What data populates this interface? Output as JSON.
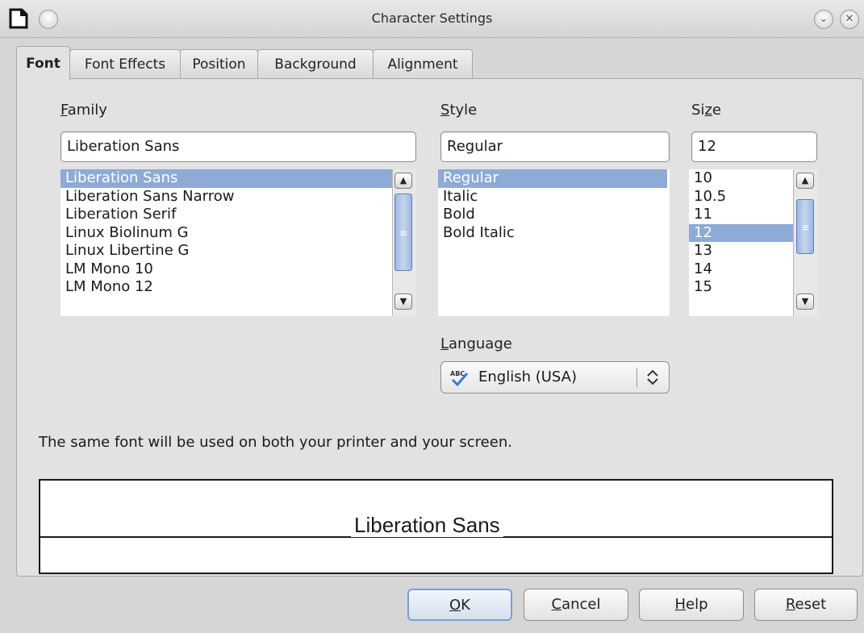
{
  "window": {
    "title": "Character Settings"
  },
  "tabs": [
    {
      "label": "Font",
      "active": true
    },
    {
      "label": "Font Effects"
    },
    {
      "label": "Position"
    },
    {
      "label": "Background"
    },
    {
      "label": "Alignment"
    }
  ],
  "family": {
    "label_mnemonic": "F",
    "label_rest": "amily",
    "value": "Liberation Sans",
    "items": [
      "Liberation Sans",
      "Liberation Sans Narrow",
      "Liberation Serif",
      "Linux Biolinum G",
      "Linux Libertine G",
      "LM Mono 10",
      "LM Mono 12"
    ],
    "selected_index": 0
  },
  "style": {
    "label_mnemonic": "S",
    "label_rest": "tyle",
    "value": "Regular",
    "items": [
      "Regular",
      "Italic",
      "Bold",
      "Bold Italic"
    ],
    "selected_index": 0
  },
  "size": {
    "label_pre": "Si",
    "label_mnemonic": "z",
    "label_rest": "e",
    "value": "12",
    "items": [
      "10",
      "10.5",
      "11",
      "12",
      "13",
      "14",
      "15"
    ],
    "selected_index": 3
  },
  "language": {
    "label_mnemonic": "L",
    "label_rest": "anguage",
    "value": "English (USA)",
    "icon": "spellcheck-abc-icon"
  },
  "info_text": "The same font will be used on both your printer and your screen.",
  "preview_text": "Liberation Sans",
  "buttons": {
    "ok": {
      "mnemonic": "O",
      "rest": "K"
    },
    "cancel": {
      "mnemonic": "C",
      "rest": "ancel"
    },
    "help": {
      "mnemonic": "H",
      "rest": "elp"
    },
    "reset": {
      "mnemonic": "R",
      "rest": "eset"
    }
  },
  "colors": {
    "selection": "#8eaad6",
    "default_button_border": "#7d9fcf"
  }
}
